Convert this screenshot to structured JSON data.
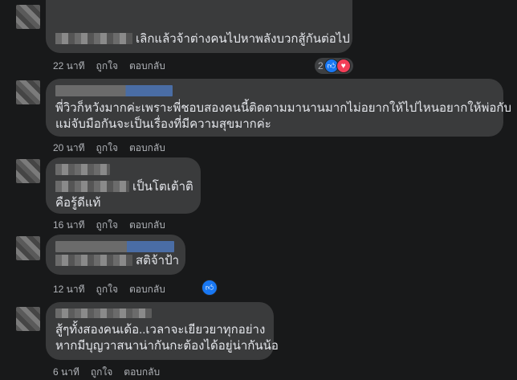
{
  "actions": {
    "like": "ถูกใจ",
    "reply": "ตอบกลับ"
  },
  "comments": [
    {
      "text": "เลิกแล้วจ้าต่างคนไปหาพลังบวกสู้กันต่อไป",
      "time": "22 นาที",
      "reactions": "2"
    },
    {
      "line1": "พี่วิวก็หวังมากค่ะเพราะพี่ชอบสองคนนี้ติดตามมานานมากไม่อยากให้ไปไหนอยากให้พ่อกับ",
      "line2": "แม่จับมือกันจะเป็นเรื่องที่มีความสุขมากค่ะ",
      "time": "20 นาที"
    },
    {
      "line1": "เป็นโตเต้าติ",
      "line2": "คือรู้ดีแท้",
      "time": "16 นาที"
    },
    {
      "text": "สติจ้าป้า",
      "time": "12 นาที"
    },
    {
      "line1": "สู้ๆทั้งสองคนเด้อ..เวลาจะเยียวยาทุกอย่าง",
      "line2": "หากมีบุญวาสนาน่ากันกะต้องได้อยู่น่ากันน้อ",
      "time": "6 นาที"
    }
  ],
  "colors": {
    "bg": "#18191a",
    "bubble": "#3a3b3c",
    "like": "#1877f2",
    "love": "#f33e58"
  }
}
